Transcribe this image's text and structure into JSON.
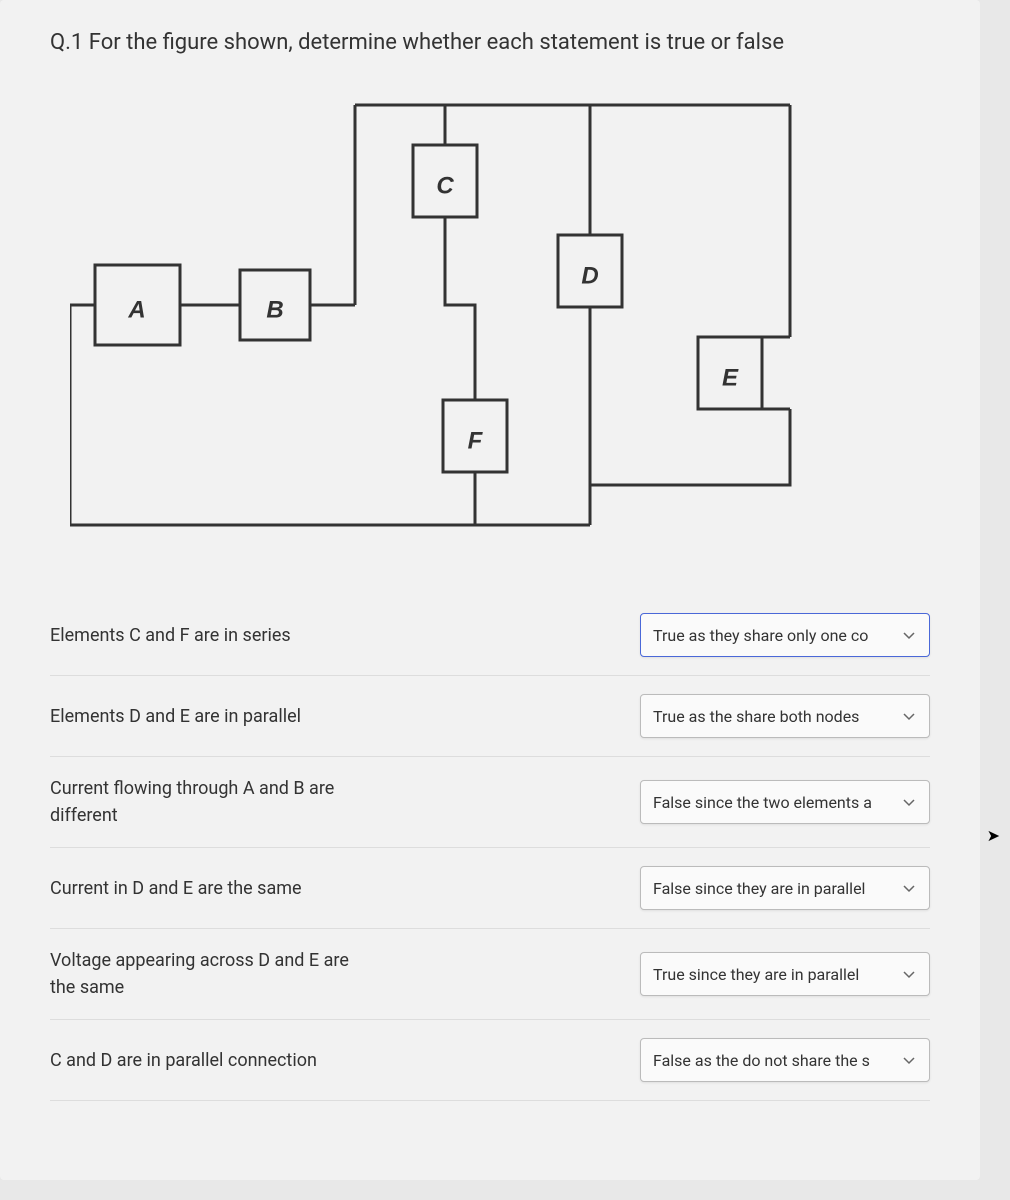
{
  "question": {
    "title": "Q.1 For the figure shown, determine whether each statement is true or false"
  },
  "circuit": {
    "elements": [
      {
        "label": "A"
      },
      {
        "label": "B"
      },
      {
        "label": "C"
      },
      {
        "label": "D"
      },
      {
        "label": "E"
      },
      {
        "label": "F"
      }
    ]
  },
  "statements": [
    {
      "text": "Elements C and F are in series",
      "selected": "True as they share only one co",
      "highlighted": true
    },
    {
      "text": "Elements D and E are in parallel",
      "selected": "True as the share both nodes",
      "highlighted": false
    },
    {
      "text": "Current flowing through A and B are different",
      "selected": "False since the two elements a",
      "highlighted": false
    },
    {
      "text": "Current in D and E are the same",
      "selected": "False since they are in parallel",
      "highlighted": false
    },
    {
      "text": "Voltage appearing across D and E are the same",
      "selected": "True since they are in parallel",
      "highlighted": false
    },
    {
      "text": "C and D are in parallel connection",
      "selected": "False as the do not share the s",
      "highlighted": false
    }
  ]
}
